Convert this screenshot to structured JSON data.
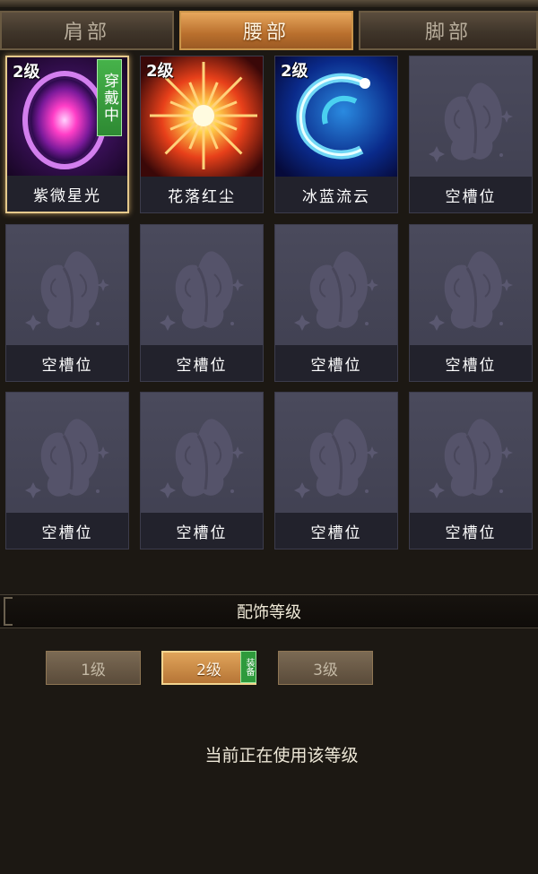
{
  "tabs": [
    {
      "label": "肩部",
      "active": false
    },
    {
      "label": "腰部",
      "active": true
    },
    {
      "label": "脚部",
      "active": false
    }
  ],
  "slots": [
    {
      "level": "2级",
      "name": "紫微星光",
      "icon": "purple-orb-icon",
      "equipped": true,
      "badge": "穿戴中"
    },
    {
      "level": "2级",
      "name": "花落红尘",
      "icon": "red-burst-icon",
      "equipped": false
    },
    {
      "level": "2级",
      "name": "冰蓝流云",
      "icon": "blue-swirl-icon",
      "equipped": false
    },
    {
      "name": "空槽位",
      "icon": "butterfly-icon",
      "empty": true
    },
    {
      "name": "空槽位",
      "icon": "butterfly-icon",
      "empty": true
    },
    {
      "name": "空槽位",
      "icon": "butterfly-icon",
      "empty": true
    },
    {
      "name": "空槽位",
      "icon": "butterfly-icon",
      "empty": true
    },
    {
      "name": "空槽位",
      "icon": "butterfly-icon",
      "empty": true
    },
    {
      "name": "空槽位",
      "icon": "butterfly-icon",
      "empty": true
    },
    {
      "name": "空槽位",
      "icon": "butterfly-icon",
      "empty": true
    },
    {
      "name": "空槽位",
      "icon": "butterfly-icon",
      "empty": true
    },
    {
      "name": "空槽位",
      "icon": "butterfly-icon",
      "empty": true
    }
  ],
  "level_section": {
    "title": "配饰等级",
    "buttons": [
      {
        "label": "1级",
        "active": false
      },
      {
        "label": "2级",
        "active": true,
        "tag": "装备"
      },
      {
        "label": "3级",
        "active": false
      }
    ],
    "status": "当前正在使用该等级"
  },
  "colors": {
    "active_tab": "#c9844a",
    "equipped_badge": "#3e9f42",
    "slot_bg": "#44445a"
  }
}
